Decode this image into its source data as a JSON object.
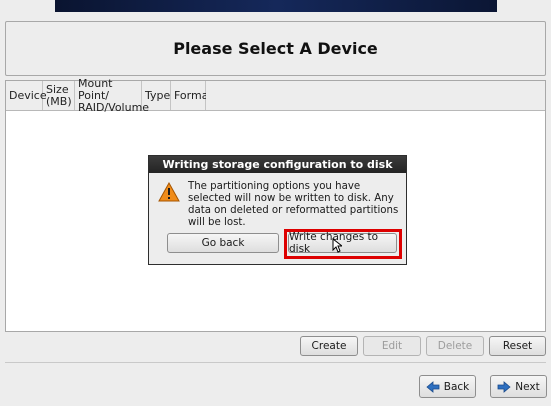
{
  "header": {
    "title": "Please Select A Device"
  },
  "table": {
    "columns": [
      {
        "line1": "Device",
        "line2": ""
      },
      {
        "line1": "Size",
        "line2": "(MB)"
      },
      {
        "line1": "Mount Point/",
        "line2": "RAID/Volume"
      },
      {
        "line1": "Type",
        "line2": ""
      },
      {
        "line1": "Format",
        "line2": ""
      }
    ]
  },
  "dialog": {
    "title": "Writing storage configuration to disk",
    "icon": "warning-icon",
    "message": "The partitioning options you have selected will now be written to disk.  Any data on deleted or reformatted partitions will be lost.",
    "go_back_label": "Go back",
    "write_label": "Write changes to disk"
  },
  "actions": {
    "create_label": "Create",
    "edit_label": "Edit",
    "delete_label": "Delete",
    "reset_label": "Reset"
  },
  "nav": {
    "back_label": "Back",
    "next_label": "Next"
  },
  "colors": {
    "highlight": "#dd0000",
    "arrow": "#2d6fc0",
    "warning": "#f08c1a"
  }
}
